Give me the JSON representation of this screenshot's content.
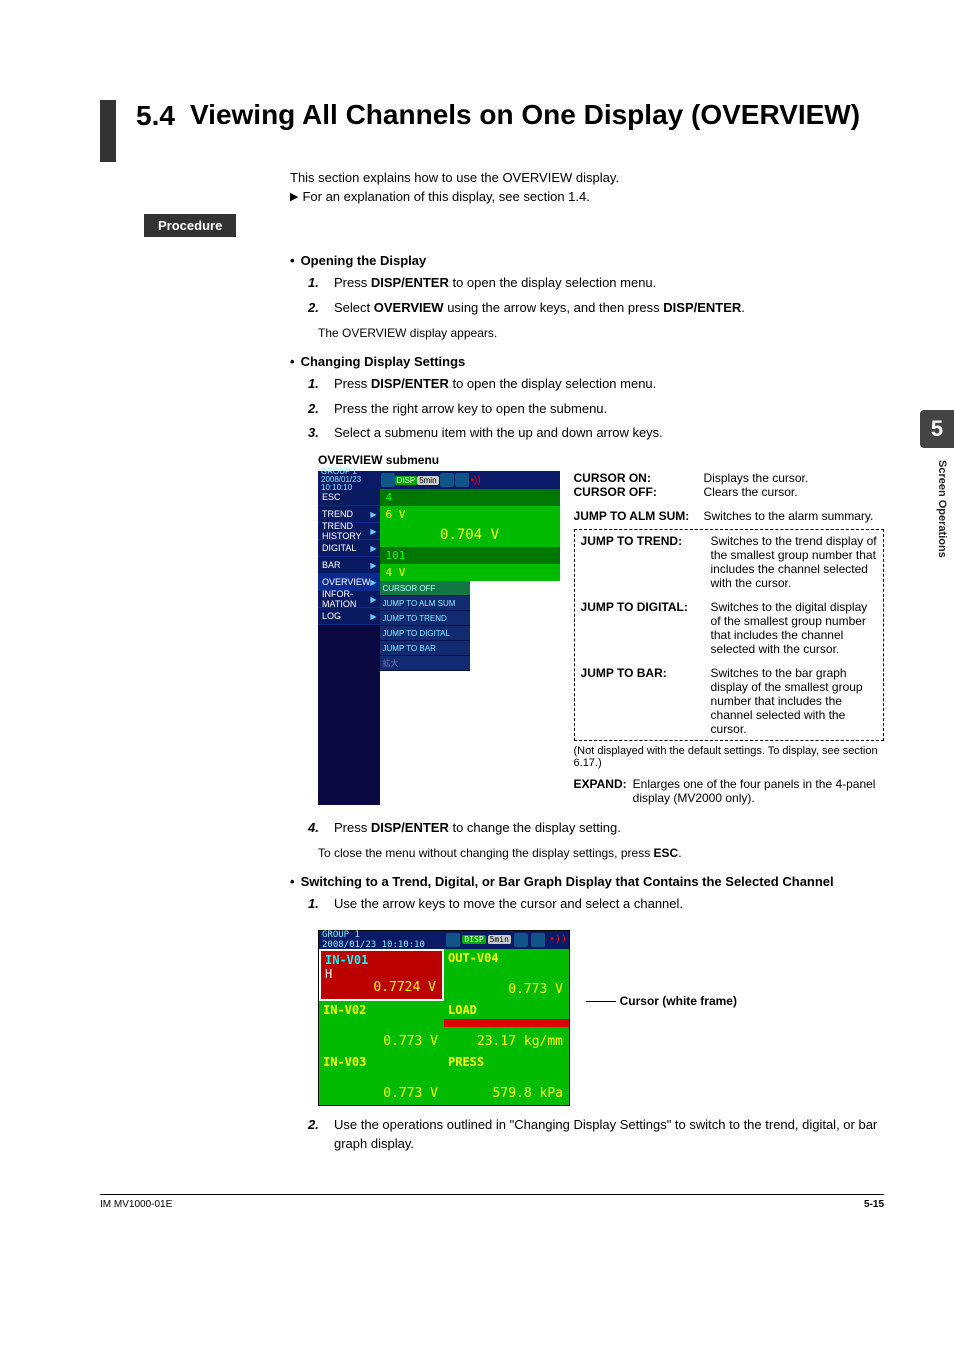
{
  "sideTab": "5",
  "sideText": "Screen Operations",
  "sectionNum": "5.4",
  "sectionTitle": "Viewing All Channels on One Display (OVERVIEW)",
  "intro1": "This section explains how to use the OVERVIEW display.",
  "intro2": "For an explanation of this display, see section 1.4.",
  "procLabel": "Procedure",
  "openHead": "Opening the Display",
  "open_s1_a": "Press ",
  "open_s1_b": "DISP/ENTER",
  "open_s1_c": " to open the display selection menu.",
  "open_s2_a": "Select ",
  "open_s2_b": "OVERVIEW",
  "open_s2_c": " using the arrow keys, and then press ",
  "open_s2_d": "DISP/ENTER",
  "open_s2_e": ".",
  "open_s2_note": "The OVERVIEW display appears.",
  "chgHead": "Changing Display Settings",
  "chg_s1_a": "Press ",
  "chg_s1_b": "DISP/ENTER",
  "chg_s1_c": " to open the display selection menu.",
  "chg_s2": "Press the right arrow key to open the submenu.",
  "chg_s3": "Select a submenu item with the up and down arrow keys.",
  "submenuLabel": "OVERVIEW submenu",
  "menu": {
    "group": "GROUP 1",
    "ts": "2008/01/23 10:10:10",
    "disp": "DISP",
    "time": "5min",
    "items": [
      "ESC",
      "TREND",
      "TREND HISTORY",
      "DIGITAL",
      "BAR",
      "OVERVIEW",
      "INFOR-MATION",
      "LOG"
    ],
    "sub": [
      "CURSOR OFF",
      "JUMP TO ALM SUM",
      "JUMP TO TREND",
      "JUMP TO DIGITAL",
      "JUMP TO BAR",
      "拡大"
    ]
  },
  "green": {
    "h4": "4",
    "l6": "6 V",
    "v": "0.704 V",
    "l101": "101",
    "l4": "4 V"
  },
  "info": {
    "curOnL": "CURSOR ON:",
    "curOn": "Displays the cursor.",
    "curOffL": "CURSOR OFF:",
    "curOff": "Clears the cursor.",
    "almL": "JUMP TO ALM SUM:",
    "alm": "Switches to the alarm summary.",
    "trendL": "JUMP TO TREND:",
    "trend": "Switches to the trend display of the smallest group number that includes the channel selected with the cursor.",
    "digL": "JUMP TO DIGITAL:",
    "dig": "Switches to the digital display of the smallest group number that includes the channel selected with the cursor.",
    "barL": "JUMP TO BAR:",
    "bar": "Switches to the bar graph display of the smallest group number that includes the channel selected with the cursor.",
    "dashNote": "(Not displayed with the default settings. To display, see section 6.17.)",
    "expL": "EXPAND:",
    "exp": "Enlarges one of the four panels in the 4-panel display (MV2000 only)."
  },
  "s4_a": "Press ",
  "s4_b": "DISP/ENTER",
  "s4_c": " to change the display setting.",
  "s4_note_a": "To close the menu without changing the display settings, press ",
  "s4_note_b": "ESC",
  "s4_note_c": ".",
  "switchHead": "Switching to a Trend, Digital, or Bar Graph Display that Contains the Selected Channel",
  "sw_s1": "Use the arrow keys to move the cursor and select a channel.",
  "shot2": {
    "group": "GROUP 1",
    "ts": "2008/01/23 10:10:10",
    "disp": "DISP",
    "time": "5min",
    "c11_tag": "IN-V01",
    "c11_h": "H",
    "c11_v": "0.7724 V",
    "c12_tag": "OUT-V04",
    "c12_v": "0.773 V",
    "c21_tag": "IN-V02",
    "c21_v": "0.773 V",
    "c22_tag": "LOAD",
    "c22_v": "23.17 kg/mm",
    "c31_tag": "IN-V03",
    "c31_v": "0.773 V",
    "c32_tag": "PRESS",
    "c32_v": "579.8 kPa"
  },
  "cursorNote": "Cursor (white frame)",
  "sw_s2": "Use the operations outlined in \"Changing Display Settings\" to switch to the trend, digital, or bar graph display.",
  "footerL": "IM MV1000-01E",
  "footerR": "5-15"
}
